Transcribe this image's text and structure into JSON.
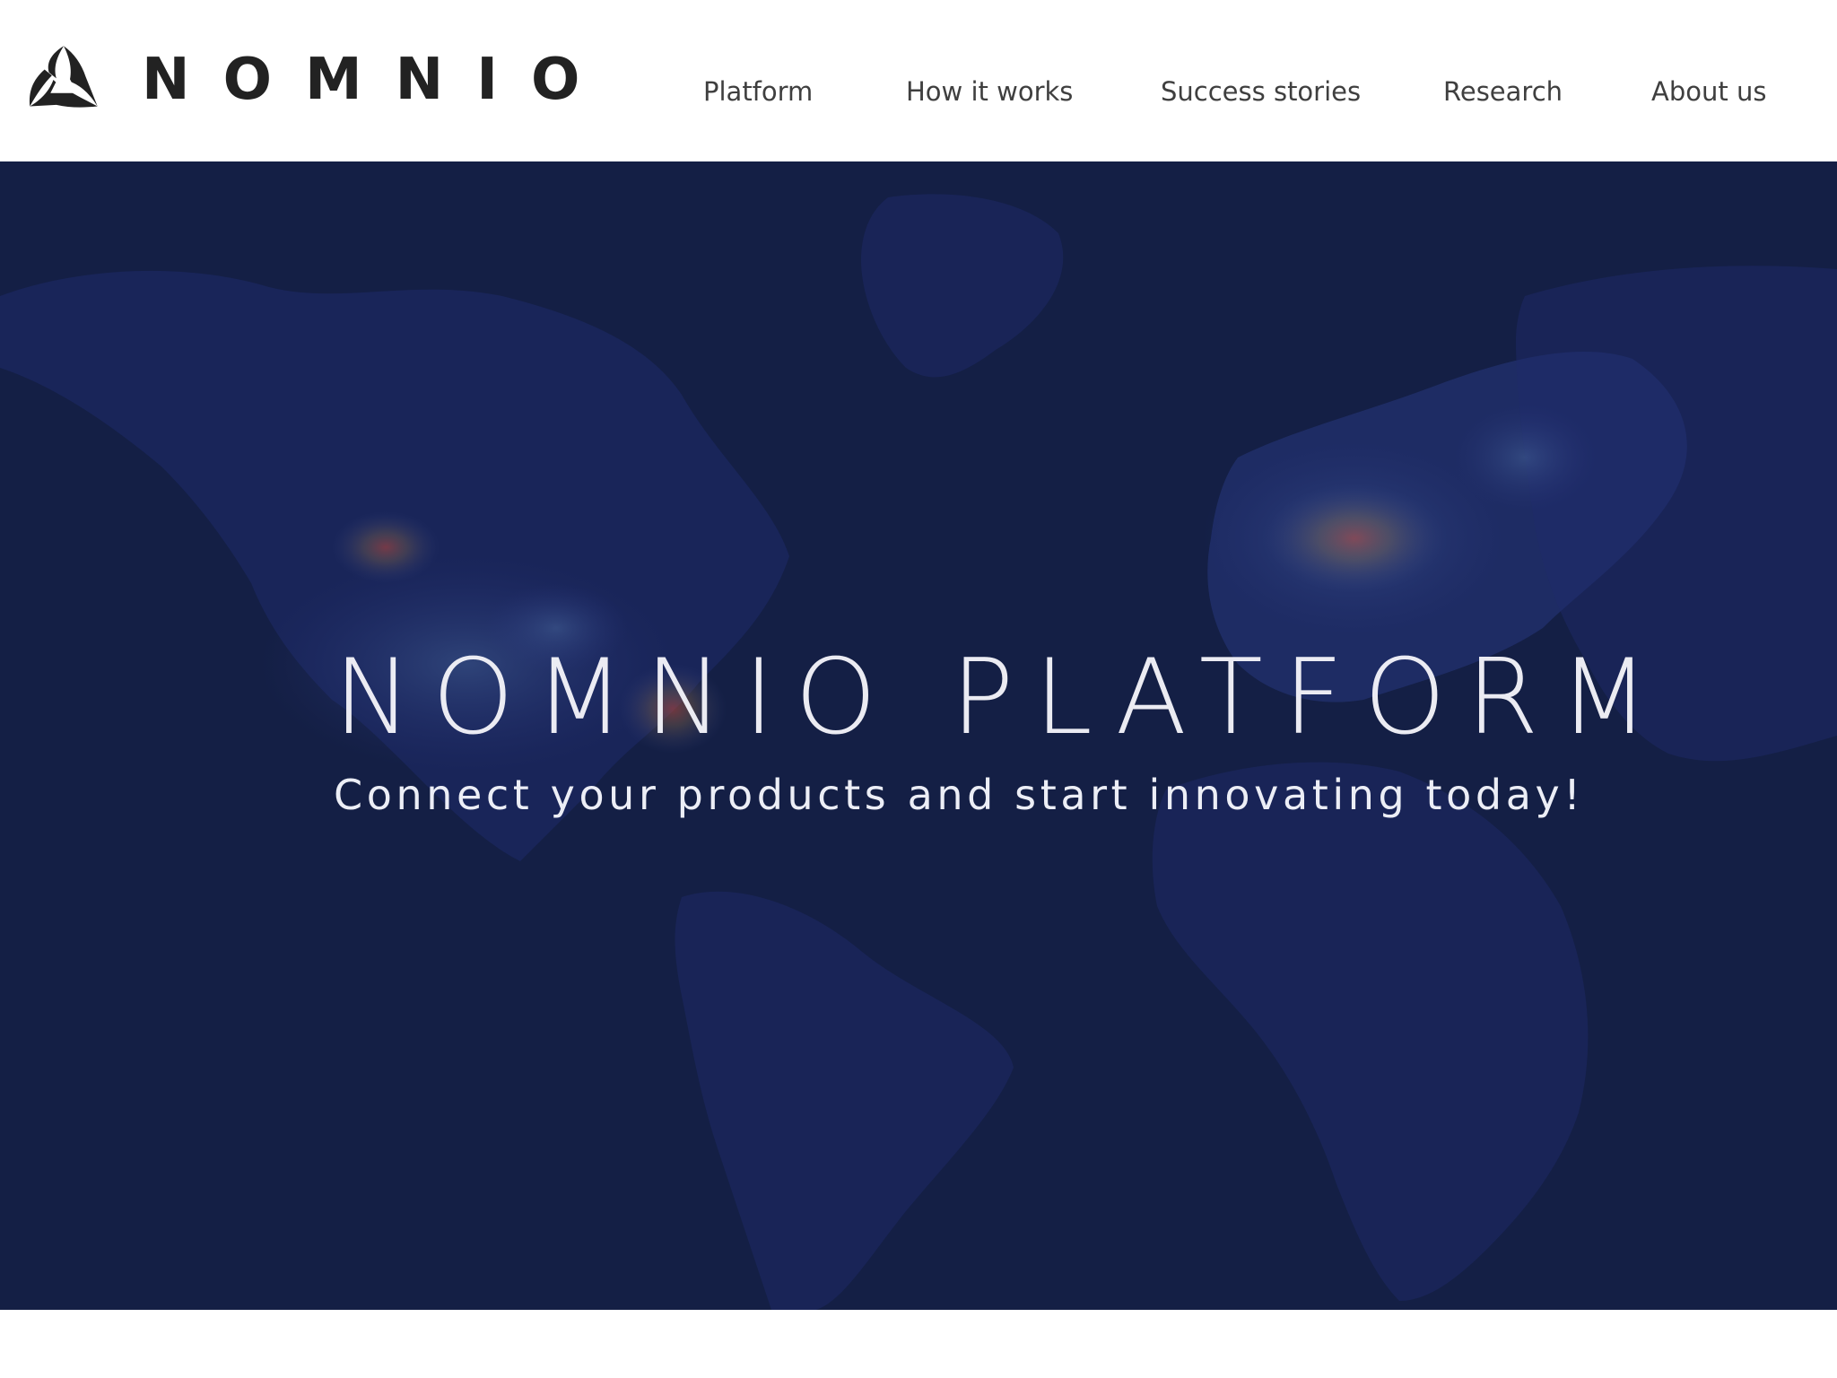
{
  "brand": {
    "name": "NOMNIO",
    "logo_icon": "nomnio-triangle-logo-icon"
  },
  "nav": {
    "items": [
      {
        "label": "Platform"
      },
      {
        "label": "How it works"
      },
      {
        "label": "Success stories"
      },
      {
        "label": "Research"
      },
      {
        "label": "About us"
      }
    ]
  },
  "hero": {
    "title": "NOMNIO PLATFORM",
    "subtitle": "Connect your products and start innovating today!",
    "background": "world-map-heatmap-image"
  },
  "colors": {
    "hero_background": "#141f45",
    "brand_text": "#222222",
    "nav_text": "#3f3f3f",
    "hero_text": "#f2f2f8"
  }
}
